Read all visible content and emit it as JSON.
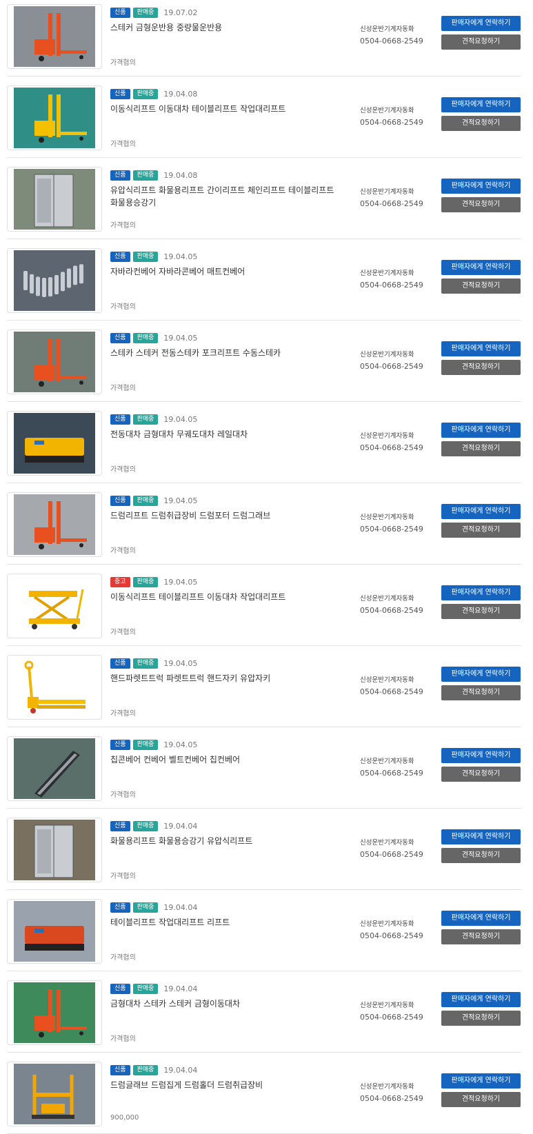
{
  "products": [
    {
      "tag": "신품",
      "tag_type": "new",
      "status": "판매중",
      "date": "19.07.02",
      "title": "스테커 금형운반용 중량물운반용",
      "price": "가격협의",
      "seller": "신성운반기계자동화",
      "phone": "0504-0668-2549",
      "contact_label": "판매자에게 연락하기",
      "quote_label": "견적요청하기",
      "img": "stacker-orange"
    },
    {
      "tag": "신품",
      "tag_type": "new",
      "status": "판매중",
      "date": "19.04.08",
      "title": "이동식리프트 이동대차 테이블리프트 작업대리프트",
      "price": "가격협의",
      "seller": "신성운반기계자동화",
      "phone": "0504-0668-2549",
      "contact_label": "판매자에게 연락하기",
      "quote_label": "견적요청하기",
      "img": "trolley-yellow"
    },
    {
      "tag": "신품",
      "tag_type": "new",
      "status": "판매중",
      "date": "19.04.08",
      "title": "유압식리프트 화물용리프트 간이리프트 체인리프트 테이블리프트 화물용승강기",
      "price": "가격협의",
      "seller": "신성운반기계자동화",
      "phone": "0504-0668-2549",
      "contact_label": "판매자에게 연락하기",
      "quote_label": "견적요청하기",
      "img": "cargo-lift"
    },
    {
      "tag": "신품",
      "tag_type": "new",
      "status": "판매중",
      "date": "19.04.05",
      "title": "자바라컨베어 자바라콘베어 매트컨베어",
      "price": "가격협의",
      "seller": "신성운반기계자동화",
      "phone": "0504-0668-2549",
      "contact_label": "판매자에게 연락하기",
      "quote_label": "견적요청하기",
      "img": "roller-conveyor"
    },
    {
      "tag": "신품",
      "tag_type": "new",
      "status": "판매중",
      "date": "19.04.05",
      "title": "스테카 스테커 전동스테카 포크리프트 수동스테카",
      "price": "가격협의",
      "seller": "신성운반기계자동화",
      "phone": "0504-0668-2549",
      "contact_label": "판매자에게 연락하기",
      "quote_label": "견적요청하기",
      "img": "stacker-red"
    },
    {
      "tag": "신품",
      "tag_type": "new",
      "status": "판매중",
      "date": "19.04.05",
      "title": "전동대차 금형대차 무궤도대차 레일대차",
      "price": "가격협의",
      "seller": "신성운반기계자동화",
      "phone": "0504-0668-2549",
      "contact_label": "판매자에게 연락하기",
      "quote_label": "견적요청하기",
      "img": "electric-cart"
    },
    {
      "tag": "신품",
      "tag_type": "new",
      "status": "판매중",
      "date": "19.04.05",
      "title": "드럼리프트 드럼취급장비 드럼포터 드럼그래브",
      "price": "가격협의",
      "seller": "신성운반기계자동화",
      "phone": "0504-0668-2549",
      "contact_label": "판매자에게 연락하기",
      "quote_label": "견적요청하기",
      "img": "drum-lift"
    },
    {
      "tag": "중고",
      "tag_type": "used",
      "status": "판매중",
      "date": "19.04.05",
      "title": "이동식리프트 테이블리프트 이동대차 작업대리프트",
      "price": "가격협의",
      "seller": "신성운반기계자동화",
      "phone": "0504-0668-2549",
      "contact_label": "판매자에게 연락하기",
      "quote_label": "견적요청하기",
      "img": "scissor-lift"
    },
    {
      "tag": "신품",
      "tag_type": "new",
      "status": "판매중",
      "date": "19.04.05",
      "title": "핸드파렛트트럭 파렛트트럭 핸드자키 유압자키",
      "price": "가격협의",
      "seller": "신성운반기계자동화",
      "phone": "0504-0668-2549",
      "contact_label": "판매자에게 연락하기",
      "quote_label": "견적요청하기",
      "img": "pallet-truck"
    },
    {
      "tag": "신품",
      "tag_type": "new",
      "status": "판매중",
      "date": "19.04.05",
      "title": "칩콘베어 컨베어 벨트컨베어 칩컨베어",
      "price": "가격협의",
      "seller": "신성운반기계자동화",
      "phone": "0504-0668-2549",
      "contact_label": "판매자에게 연락하기",
      "quote_label": "견적요청하기",
      "img": "chip-conveyor"
    },
    {
      "tag": "신품",
      "tag_type": "new",
      "status": "판매중",
      "date": "19.04.04",
      "title": "화물용리프트 화물용승강기 유압식리프트",
      "price": "가격협의",
      "seller": "신성운반기계자동화",
      "phone": "0504-0668-2549",
      "contact_label": "판매자에게 연락하기",
      "quote_label": "견적요청하기",
      "img": "freight-elevator"
    },
    {
      "tag": "신품",
      "tag_type": "new",
      "status": "판매중",
      "date": "19.04.04",
      "title": "테이블리프트 작업대리프트 리프트",
      "price": "가격협의",
      "seller": "신성운반기계자동화",
      "phone": "0504-0668-2549",
      "contact_label": "판매자에게 연락하기",
      "quote_label": "견적요청하기",
      "img": "table-lift"
    },
    {
      "tag": "신품",
      "tag_type": "new",
      "status": "판매중",
      "date": "19.04.04",
      "title": "금형대차 스테카 스테커 금형이동대차",
      "price": "가격협의",
      "seller": "신성운반기계자동화",
      "phone": "0504-0668-2549",
      "contact_label": "판매자에게 연락하기",
      "quote_label": "견적요청하기",
      "img": "mold-stacker"
    },
    {
      "tag": "신품",
      "tag_type": "new",
      "status": "판매중",
      "date": "19.04.04",
      "title": "드럼글래브 드럼집게 드럼홀더 드럼취급장비",
      "price": "900,000",
      "seller": "신성운반기계자동화",
      "phone": "0504-0668-2549",
      "contact_label": "판매자에게 연락하기",
      "quote_label": "견적요청하기",
      "img": "drum-grab"
    }
  ]
}
